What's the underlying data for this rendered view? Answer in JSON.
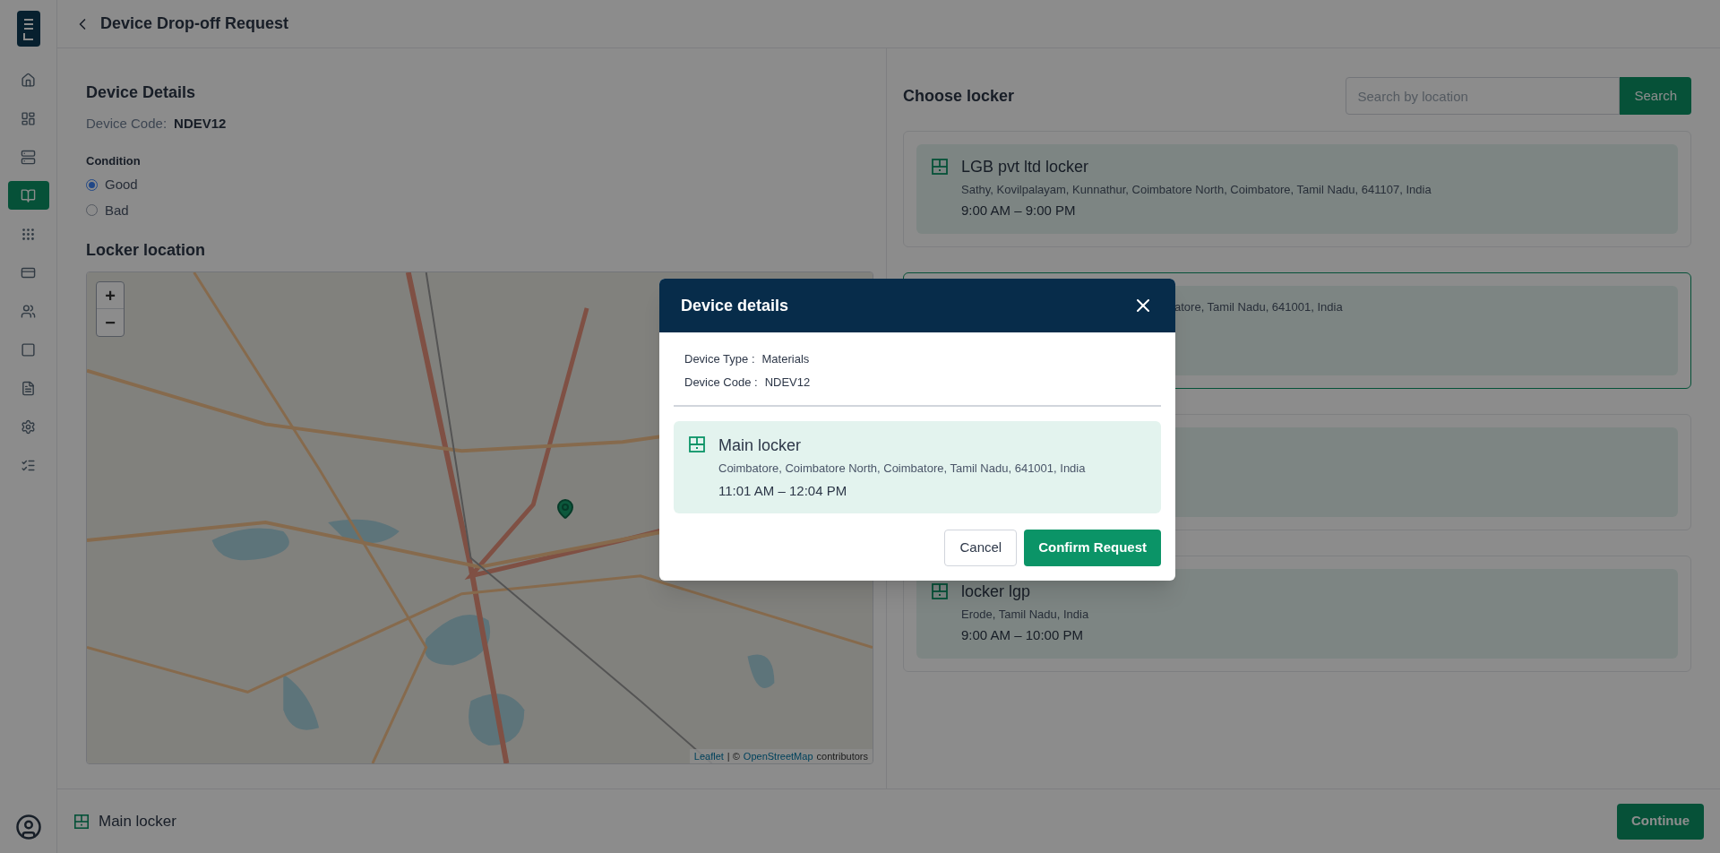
{
  "header": {
    "title": "Device Drop-off Request"
  },
  "sidebar": {
    "items": [
      {
        "selected": false
      },
      {
        "selected": false
      },
      {
        "selected": false
      },
      {
        "selected": true
      },
      {
        "selected": false
      },
      {
        "selected": false
      },
      {
        "selected": false
      },
      {
        "selected": false
      },
      {
        "selected": false
      },
      {
        "selected": false
      },
      {
        "selected": false
      }
    ]
  },
  "device_details": {
    "title": "Device Details",
    "code_label": "Device Code:",
    "code_value": "NDEV12"
  },
  "condition": {
    "label": "Condition",
    "options": [
      {
        "label": "Good",
        "selected": true
      },
      {
        "label": "Bad",
        "selected": false
      }
    ]
  },
  "locker_location": {
    "title": "Locker location",
    "map": {
      "zoom_in": "+",
      "zoom_out": "−",
      "attribution_link": "Leaflet",
      "attribution_sep": "| ©",
      "attribution_osm": "OpenStreetMap",
      "attribution_suffix": "contributors"
    }
  },
  "choose_locker": {
    "title": "Choose locker",
    "search": {
      "placeholder": "Search by location",
      "button": "Search"
    },
    "lockers": [
      {
        "name": "LGB pvt ltd locker",
        "address": "Sathy, Kovilpalayam, Kunnathur, Coimbatore North, Coimbatore, Tamil Nadu, 641107, India",
        "hours": "9:00 AM – 9:00 PM",
        "selected": false
      },
      {
        "address": "atore, Tamil Nadu, 641001, India",
        "selected": true
      },
      {
        "selected": false
      },
      {
        "name": "locker lgp",
        "address": "Erode, Tamil Nadu, India",
        "hours": "9:00 AM – 10:00 PM",
        "selected": false
      }
    ]
  },
  "footer": {
    "selected_locker": "Main locker",
    "continue": "Continue"
  },
  "modal": {
    "title": "Device details",
    "fields": [
      {
        "label": "Device Type :",
        "value": "Materials"
      },
      {
        "label": "Device Code :",
        "value": "NDEV12"
      }
    ],
    "locker": {
      "name": "Main locker",
      "address": "Coimbatore, Coimbatore North, Coimbatore, Tamil Nadu, 641001, India",
      "hours": "11:01 AM – 12:04 PM"
    },
    "cancel": "Cancel",
    "confirm": "Confirm Request"
  }
}
